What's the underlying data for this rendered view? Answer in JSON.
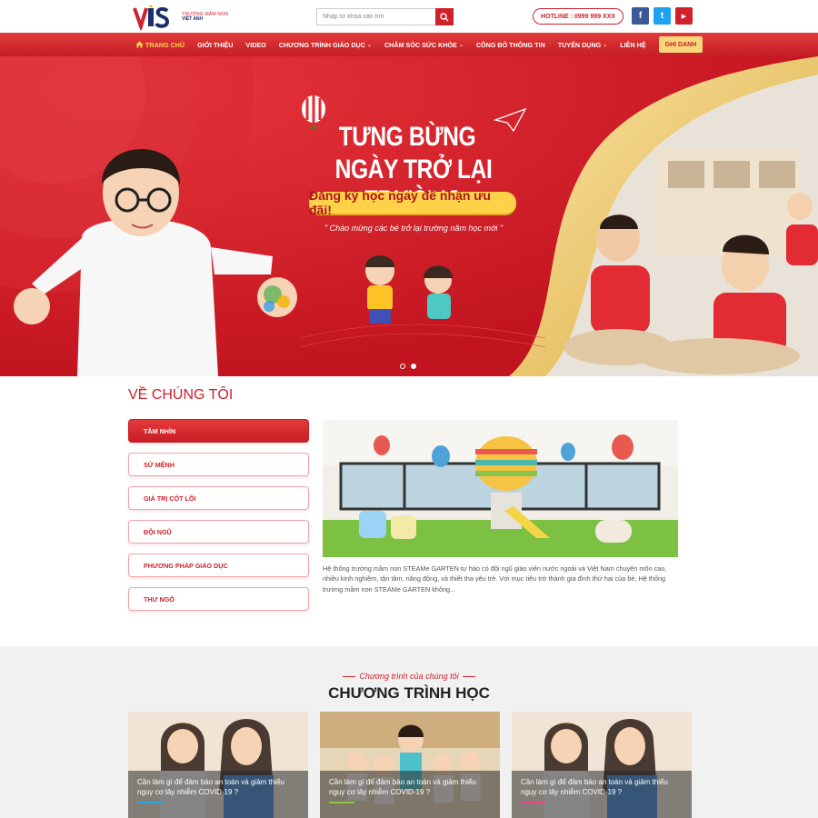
{
  "header": {
    "logo_text": "VIS",
    "logo_line1": "TRƯỜNG MẦM NON",
    "logo_line2": "VIỆT ANH",
    "search_placeholder": "Nhập từ khóa cần tìm",
    "hotline": "HOTLINE : 0999 999 XXX",
    "socials": [
      {
        "name": "facebook",
        "glyph": "f",
        "color": "#3b5998"
      },
      {
        "name": "twitter",
        "glyph": "t",
        "color": "#1da1f2"
      },
      {
        "name": "youtube",
        "glyph": "▶",
        "color": "#d0202a"
      }
    ]
  },
  "nav": {
    "items": [
      {
        "label": "TRANG CHỦ",
        "active": true,
        "icon": "home-icon"
      },
      {
        "label": "GIỚI THIỆU"
      },
      {
        "label": "VIDEO"
      },
      {
        "label": "CHƯƠNG TRÌNH GIÁO DỤC",
        "dropdown": true
      },
      {
        "label": "CHĂM SÓC SỨC KHỎE",
        "dropdown": true
      },
      {
        "label": "CÔNG BỐ THÔNG TIN"
      },
      {
        "label": "TUYỂN DỤNG",
        "dropdown": true
      },
      {
        "label": "LIÊN HỆ"
      }
    ],
    "cta": "GHI DANH"
  },
  "hero": {
    "title_line1": "TƯNG BỪNG",
    "title_line2": "NGÀY TRỞ LẠI TRƯỜNG",
    "pill": "Đăng ký học ngay để nhận ưu đãi!",
    "subtitle": "\" Chào mừng các bé trở lại trường năm học mới \"",
    "slides": 2,
    "active_slide": 2
  },
  "about": {
    "title": "VỀ CHÚNG TÔI",
    "tabs": [
      "TẦM NHÌN",
      "SỨ MỆNH",
      "GIÁ TRỊ CỐT LÕI",
      "ĐỘI NGŨ",
      "PHƯƠNG PHÁP GIÁO DỤC",
      "THƯ NGỎ"
    ],
    "active_tab": 0,
    "text": "Hệ thống trường mầm non STEAMe GARTEN tự hào có đội ngũ giáo viên nước ngoài và Việt Nam chuyên môn cao, nhiều kinh nghiệm, tận tâm, năng động, và thiết tha yêu trẻ. Với mục tiêu trở thành gia đình thứ hai của bé, Hệ thống trường mầm non STEAMe GARTEN không..."
  },
  "programs": {
    "subtitle": "Chương trình của chúng tôi",
    "title": "CHƯƠNG TRÌNH HỌC",
    "cards": [
      {
        "caption": "Cần làm gì để đảm bảo an toàn và giảm thiểu nguy cơ lây nhiễm COVID-19 ?",
        "bar_color": "#2aa7e0"
      },
      {
        "caption": "Cần làm gì để đảm bảo an toàn và giảm thiểu nguy cơ lây nhiễm COVID-19 ?",
        "bar_color": "#8cc63f"
      },
      {
        "caption": "Cần làm gì để đảm bảo an toàn và giảm thiểu nguy cơ lây nhiễm COVID-19 ?",
        "bar_color": "#e84d8a"
      }
    ]
  },
  "colors": {
    "brand_red": "#d0202a",
    "accent_yellow": "#ffd24a"
  }
}
